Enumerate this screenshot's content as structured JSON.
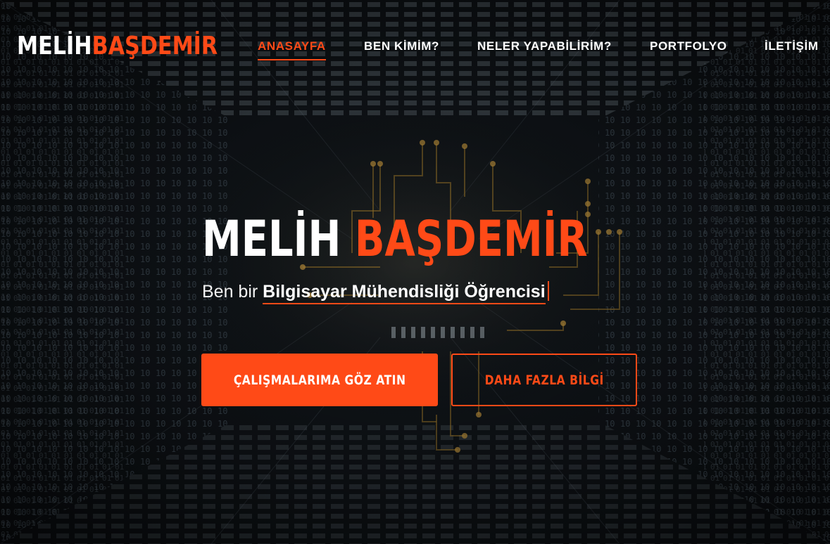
{
  "brand": {
    "first": "MELİH",
    "last": "BAŞDEMİR"
  },
  "nav": {
    "items": [
      {
        "label": "ANASAYFA",
        "active": true
      },
      {
        "label": "BEN KİMİM?",
        "active": false
      },
      {
        "label": "NELER YAPABİLİRİM?",
        "active": false
      },
      {
        "label": "PORTFOLYO",
        "active": false
      },
      {
        "label": "İLETİŞİM",
        "active": false
      }
    ]
  },
  "hero": {
    "title_first": "MELİH",
    "title_last": "BAŞDEMİR",
    "subtitle_prefix": "Ben bir",
    "subtitle_typed": "Bilgisayar Mühendisliği Öğrencisi",
    "primary_button": "ÇALIŞMALARIMA GÖZ ATIN",
    "secondary_button": "DAHA FAZLA BİLGİ"
  },
  "colors": {
    "accent": "#ff4a17",
    "text": "#ffffff",
    "background": "#0d1014"
  }
}
